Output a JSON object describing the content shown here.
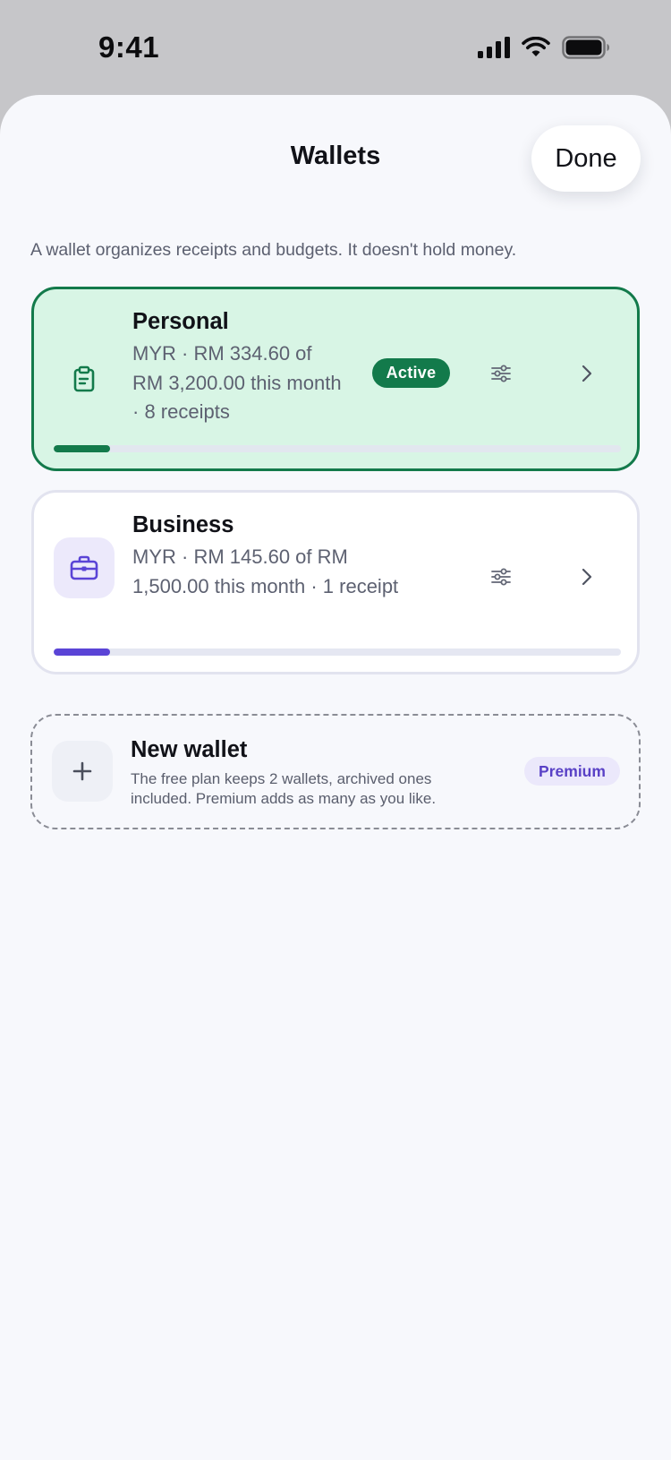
{
  "status_bar": {
    "time": "9:41",
    "icons": [
      "cellular-signal-icon",
      "wifi-icon",
      "battery-icon"
    ]
  },
  "sheet": {
    "title": "Wallets",
    "done_label": "Done",
    "intro": "A wallet organizes receipts and budgets. It doesn't hold money."
  },
  "wallets": [
    {
      "name": "Personal",
      "detail": "MYR · RM 334.60 of RM 3,200.00 this month · 8 receipts",
      "badge": "Active",
      "icon": "clipboard-icon",
      "accent": "#137a4b",
      "progress": 0.1
    },
    {
      "name": "Business",
      "detail": "MYR · RM 145.60 of RM 1,500.00 this month · 1 receipt",
      "icon": "briefcase-icon",
      "accent": "#5a44d6",
      "progress": 0.1
    }
  ],
  "new_wallet": {
    "title": "New wallet",
    "description": "The free plan keeps 2 wallets, archived ones included. Premium adds as many as you like.",
    "badge": "Premium",
    "icon": "plus-icon"
  },
  "colors": {
    "active_green": "#137a4b",
    "active_bg": "#d8f5e5",
    "business_purple": "#5a44d6",
    "premium_text": "#5941c6",
    "sheet_bg": "#f7f8fc"
  }
}
